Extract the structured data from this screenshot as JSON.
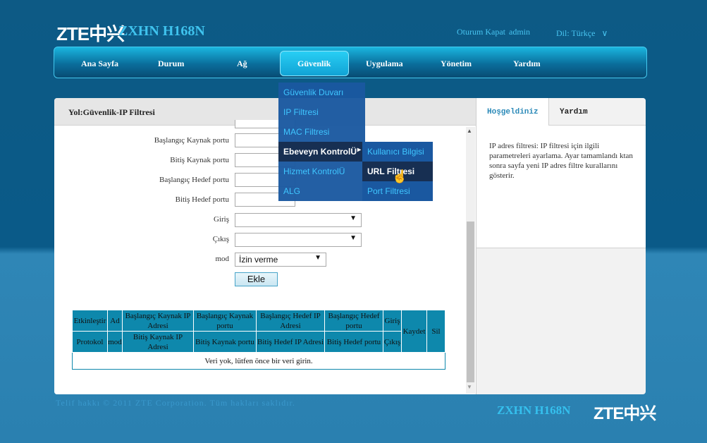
{
  "header": {
    "logo": "ZTE中兴",
    "model": "ZXHN H168N",
    "logout": "Oturum Kapat",
    "user": "admin",
    "language": "Dil: Türkçe",
    "language_arrow": "∨"
  },
  "nav": {
    "items": [
      "Ana Sayfa",
      "Durum",
      "Ağ",
      "Güvenlik",
      "Uygulama",
      "Yönetim",
      "Yardım"
    ],
    "active": "Güvenlik"
  },
  "breadcrumb": "Yol:Güvenlik-IP Filtresi",
  "right_panel": {
    "tab_welcome": "Hoşgeldiniz",
    "tab_help": "Yardım",
    "help_text": "IP adres filtresi: IP filtresi için ilgili parametreleri ayarlama. Ayar tamamlandı ktan sonra sayfa yeni IP adres filtre kurallarını gösterir."
  },
  "form": {
    "labels": {
      "src_port_start": "Başlangıç Kaynak portu",
      "src_port_end": "Bitiş Kaynak portu",
      "dst_port_start": "Başlangıç Hedef portu",
      "dst_port_end": "Bitiş Hedef portu",
      "ingress": "Giriş",
      "egress": "Çıkış",
      "mode": "mod"
    },
    "ingress_value": "",
    "egress_value": "",
    "mode_value": "İzin verme",
    "add_button": "Ekle"
  },
  "table": {
    "header_row1": [
      "Etkinleştir",
      "Ad",
      "Başlangıç Kaynak IP Adresi",
      "Başlangıç Kaynak portu",
      "Başlangıç Hedef IP Adresi",
      "Başlangıç Hedef portu",
      "Giriş",
      "Kaydet",
      "Sil"
    ],
    "header_row2": [
      "Protokol",
      "mod",
      "Bitiş Kaynak IP Adresi",
      "Bitiş Kaynak portu",
      "Bitiş Hedef IP Adresi",
      "Bitiş Hedef portu",
      "Çıkış"
    ],
    "empty_message": "Veri yok, lütfen önce bir veri girin."
  },
  "menu": {
    "items": [
      "Güvenlik Duvarı",
      "IP Filtresi",
      "MAC Filtresi",
      "Ebeveyn KontrolÜ",
      "Hizmet KontrolÜ",
      "ALG"
    ],
    "active": "Ebeveyn KontrolÜ",
    "submenu_items": [
      "Kullanıcı Bilgisi",
      "URL Filtresi",
      "Port Filtresi"
    ],
    "submenu_active": "URL Filtresi"
  },
  "footer": {
    "copyright": "Telif hakkı © 2011 ZTE Corporation. Tüm hakları saklıdır.",
    "model": "ZXHN H168N",
    "logo": "ZTE中兴"
  },
  "colors": {
    "accent": "#0e88ac",
    "nav_active": "#28cef4",
    "menu_bg": "#1a58a0",
    "menu_active": "#172f52"
  }
}
